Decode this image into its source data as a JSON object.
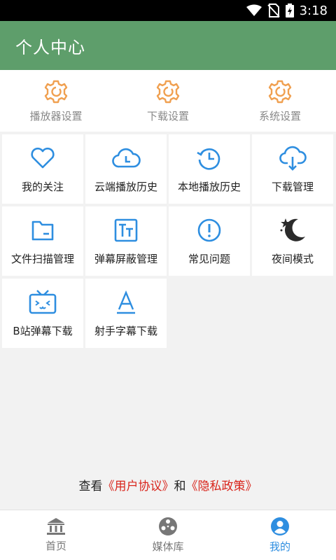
{
  "status": {
    "time": "3:18"
  },
  "header": {
    "title": "个人中心"
  },
  "quick": [
    {
      "label": "播放器设置"
    },
    {
      "label": "下载设置"
    },
    {
      "label": "系统设置"
    }
  ],
  "grid": [
    {
      "label": "我的关注",
      "icon": "heart-icon"
    },
    {
      "label": "云端播放历史",
      "icon": "cloud-clock-icon"
    },
    {
      "label": "本地播放历史",
      "icon": "history-clock-icon"
    },
    {
      "label": "下载管理",
      "icon": "cloud-download-icon"
    },
    {
      "label": "文件扫描管理",
      "icon": "folder-icon"
    },
    {
      "label": "弹幕屏蔽管理",
      "icon": "text-block-icon"
    },
    {
      "label": "常见问题",
      "icon": "info-icon"
    },
    {
      "label": "夜间模式",
      "icon": "moon-icon"
    },
    {
      "label": "B站弹幕下载",
      "icon": "bilibili-tv-icon"
    },
    {
      "label": "射手字幕下载",
      "icon": "letter-a-icon"
    }
  ],
  "agreement": {
    "prefix": "查看",
    "terms": "《用户协议》",
    "and": "和",
    "privacy": "《隐私政策》"
  },
  "nav": [
    {
      "label": "首页"
    },
    {
      "label": "媒体库"
    },
    {
      "label": "我的"
    }
  ],
  "colors": {
    "header": "#5e9e6b",
    "accent": "#2e8ee0",
    "orange": "#f0a050",
    "link": "#d9251c"
  }
}
